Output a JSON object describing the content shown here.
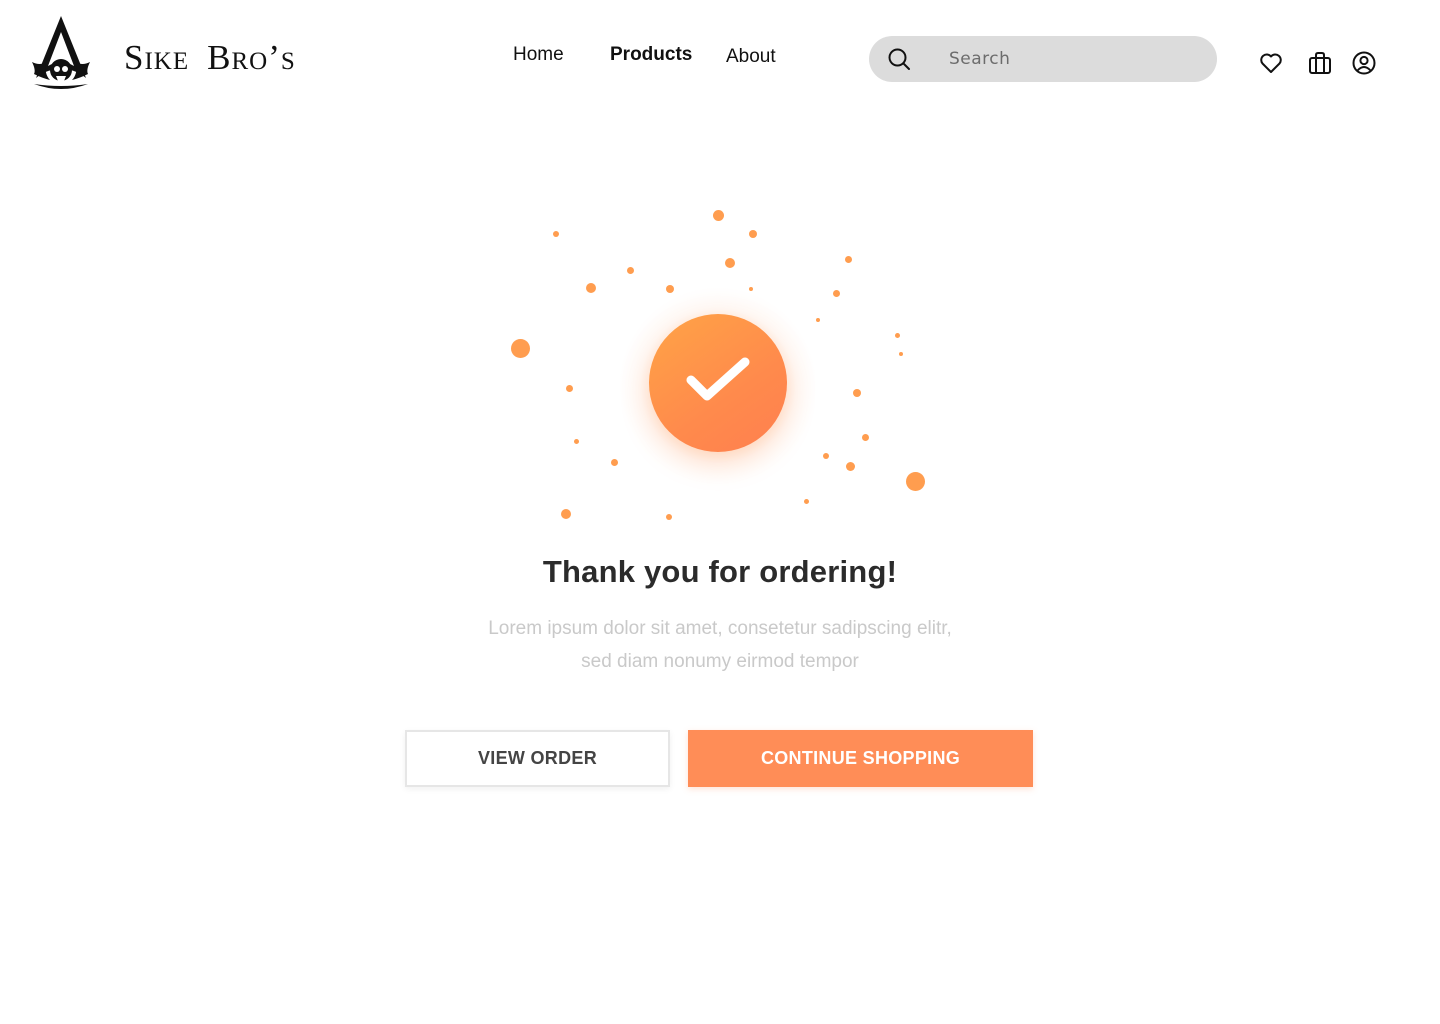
{
  "brand": {
    "words": [
      "Sike",
      "Bro’s"
    ]
  },
  "nav": {
    "home": "Home",
    "products": "Products",
    "about": "About"
  },
  "search": {
    "placeholder": "Search"
  },
  "icons": {
    "search": "search-icon",
    "heart": "heart-icon",
    "bag": "shopping-bag-icon",
    "user": "user-circle-icon",
    "check": "check-icon"
  },
  "confirmation": {
    "title": "Thank you for ordering!",
    "subtitle_line1": "Lorem ipsum dolor sit amet, consetetur sadipscing elitr,",
    "subtitle_line2": "sed diam nonumy eirmod tempor"
  },
  "buttons": {
    "view_order": "VIEW ORDER",
    "continue_shopping": "CONTINUE SHOPPING"
  },
  "colors": {
    "accent": "#ff8d57",
    "badge": "#ff9347",
    "search_bg": "#dcdcdc",
    "text_dark": "#2b2b2b",
    "text_muted": "#c9c9c9"
  }
}
